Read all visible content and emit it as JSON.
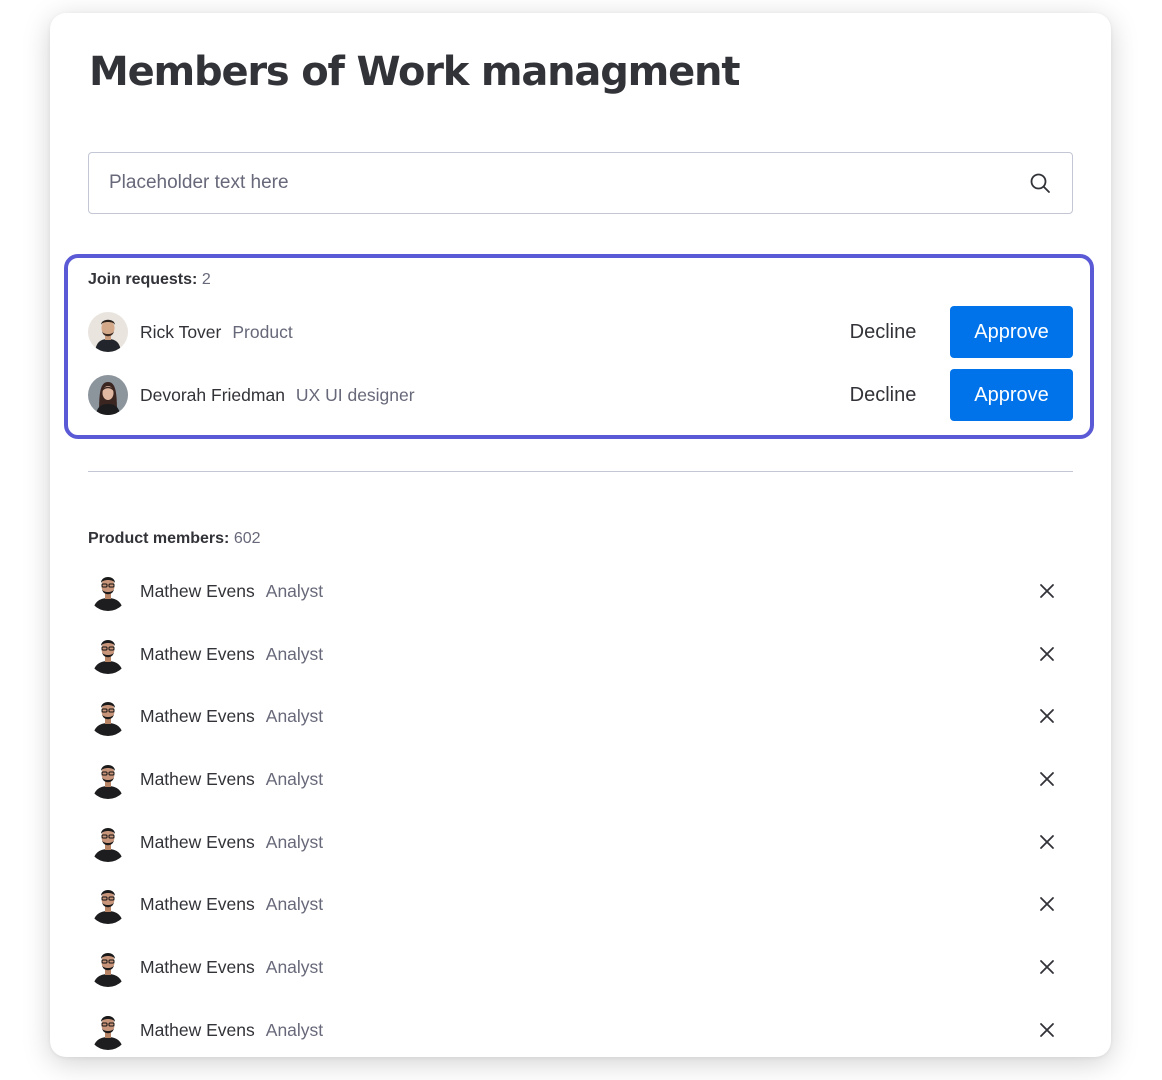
{
  "page": {
    "title": "Members of Work managment"
  },
  "search": {
    "placeholder": "Placeholder text here",
    "icon": "search-icon"
  },
  "join_requests": {
    "label": "Join requests:",
    "count": "2",
    "items": [
      {
        "name": "Rick Tover",
        "role": "Product",
        "decline_label": "Decline",
        "approve_label": "Approve"
      },
      {
        "name": "Devorah Friedman",
        "role": "UX UI designer",
        "decline_label": "Decline",
        "approve_label": "Approve"
      }
    ]
  },
  "members": {
    "label": "Product members:",
    "count": "602",
    "items": [
      {
        "name": "Mathew Evens",
        "role": "Analyst"
      },
      {
        "name": "Mathew Evens",
        "role": "Analyst"
      },
      {
        "name": "Mathew Evens",
        "role": "Analyst"
      },
      {
        "name": "Mathew Evens",
        "role": "Analyst"
      },
      {
        "name": "Mathew Evens",
        "role": "Analyst"
      },
      {
        "name": "Mathew Evens",
        "role": "Analyst"
      },
      {
        "name": "Mathew Evens",
        "role": "Analyst"
      },
      {
        "name": "Mathew Evens",
        "role": "Analyst"
      }
    ],
    "remove_icon": "close-icon"
  },
  "colors": {
    "accent": "#0073ea",
    "highlight_border": "#5b5ad6",
    "text_primary": "#323338",
    "text_secondary": "#676879"
  }
}
